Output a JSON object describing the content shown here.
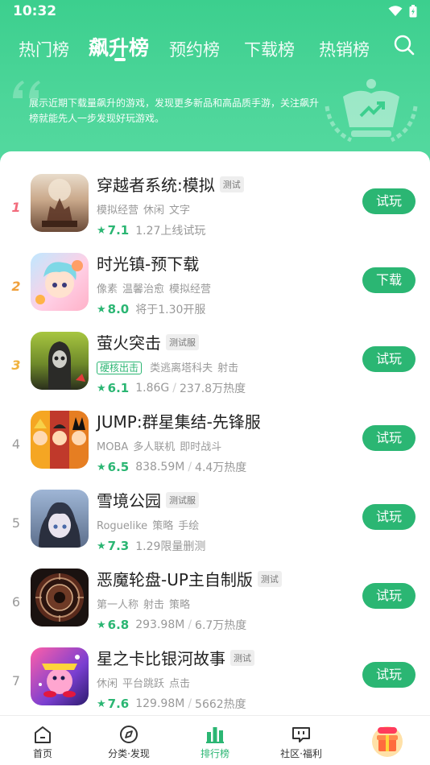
{
  "status": {
    "time": "10:32"
  },
  "tabs": [
    {
      "label": "热门榜"
    },
    {
      "label": "飙升榜"
    },
    {
      "label": "预约榜"
    },
    {
      "label": "下载榜"
    },
    {
      "label": "热销榜"
    }
  ],
  "banner": {
    "description": "展示近期下载量飙升的游戏，发现更多新品和高品质手游，关注飙升榜就能先人一步发现好玩游戏。"
  },
  "games": [
    {
      "rank": "1",
      "title": "穿越者系统:模拟",
      "badge": "测试",
      "tags": [
        "模拟经营",
        "休闲",
        "文字"
      ],
      "score": "7.1",
      "info1": "1.27上线试玩",
      "info2": "",
      "action": "试玩"
    },
    {
      "rank": "2",
      "title": "时光镇-预下载",
      "badge": "",
      "tags": [
        "像素",
        "温馨治愈",
        "模拟经营"
      ],
      "score": "8.0",
      "info1": "将于1.30开服",
      "info2": "",
      "action": "下载"
    },
    {
      "rank": "3",
      "title": "萤火突击",
      "badge": "测试服",
      "highlight_tag": "硬核出击",
      "tags": [
        "类逃离塔科夫",
        "射击"
      ],
      "score": "6.1",
      "info1": "1.86G",
      "info2": "237.8万热度",
      "action": "试玩"
    },
    {
      "rank": "4",
      "title": "JUMP:群星集结-先锋服",
      "badge": "",
      "tags": [
        "MOBA",
        "多人联机",
        "即时战斗"
      ],
      "score": "6.5",
      "info1": "838.59M",
      "info2": "4.4万热度",
      "action": "试玩"
    },
    {
      "rank": "5",
      "title": "雪境公园",
      "badge": "测试服",
      "tags": [
        "Roguelike",
        "策略",
        "手绘"
      ],
      "score": "7.3",
      "info1": "1.29限量删测",
      "info2": "",
      "action": "试玩"
    },
    {
      "rank": "6",
      "title": "恶魔轮盘-UP主自制版",
      "badge": "测试",
      "tags": [
        "第一人称",
        "射击",
        "策略"
      ],
      "score": "6.8",
      "info1": "293.98M",
      "info2": "6.7万热度",
      "action": "试玩"
    },
    {
      "rank": "7",
      "title": "星之卡比银河故事",
      "badge": "测试",
      "tags": [
        "休闲",
        "平台跳跃",
        "点击"
      ],
      "score": "7.6",
      "info1": "129.98M",
      "info2": "5662热度",
      "action": "试玩"
    }
  ],
  "nav": [
    {
      "label": "首页",
      "icon": "home-icon"
    },
    {
      "label": "分类·发现",
      "icon": "compass-icon"
    },
    {
      "label": "排行榜",
      "icon": "ranking-icon"
    },
    {
      "label": "社区·福利",
      "icon": "community-icon"
    },
    {
      "label": "",
      "icon": "gift-icon"
    }
  ],
  "colors": {
    "accent": "#2bb673",
    "header": "#3ccf8e"
  }
}
